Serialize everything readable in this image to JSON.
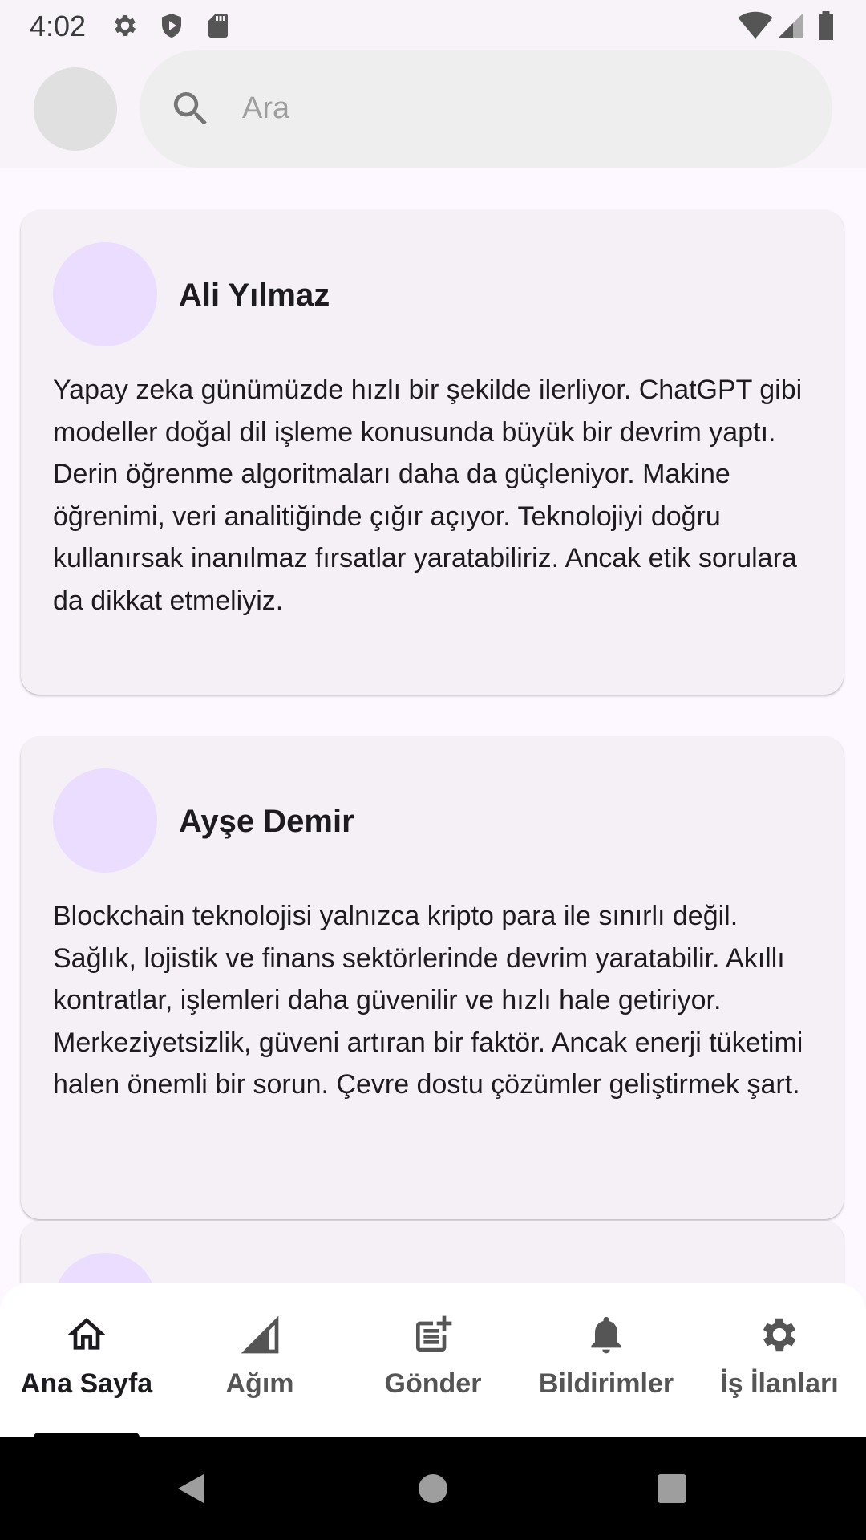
{
  "status_bar": {
    "time": "4:02",
    "icons": [
      "settings-icon",
      "shield-icon",
      "sd-card-icon",
      "wifi-icon",
      "signal-icon",
      "battery-icon"
    ]
  },
  "top_bar": {
    "search": {
      "placeholder": "Ara",
      "value": ""
    }
  },
  "posts": [
    {
      "author": "Ali Yılmaz",
      "body": "Yapay zeka günümüzde hızlı bir şekilde ilerliyor. ChatGPT gibi modeller doğal dil işleme konusunda büyük bir devrim yaptı. Derin öğrenme algoritmaları daha da güçleniyor. Makine öğrenimi, veri analitiğinde çığır açıyor. Teknolojiyi doğru kullanırsak inanılmaz fırsatlar yaratabiliriz. Ancak etik sorulara da dikkat etmeliyiz."
    },
    {
      "author": "Ayşe Demir",
      "body": "Blockchain teknolojisi yalnızca kripto para ile sınırlı değil. Sağlık, lojistik ve finans sektörlerinde devrim yaratabilir. Akıllı kontratlar, işlemleri daha güvenilir ve hızlı hale getiriyor. Merkeziyetsizlik, güveni artıran bir faktör. Ancak enerji tüketimi halen önemli bir sorun. Çevre dostu çözümler geliştirmek şart."
    }
  ],
  "bottom_nav": {
    "items": [
      {
        "label": "Ana Sayfa",
        "icon": "home-icon",
        "active": true
      },
      {
        "label": "Ağım",
        "icon": "network-signal-icon",
        "active": false
      },
      {
        "label": "Gönder",
        "icon": "post-add-icon",
        "active": false
      },
      {
        "label": "Bildirimler",
        "icon": "bell-icon",
        "active": false
      },
      {
        "label": "İş İlanları",
        "icon": "gear-icon",
        "active": false
      }
    ]
  },
  "colors": {
    "background": "#fdf7ff",
    "app_bar": "#f7f3f9",
    "card": "#f5f0f6",
    "avatar_placeholder": "#eaddff",
    "text": "#1d1b20"
  }
}
